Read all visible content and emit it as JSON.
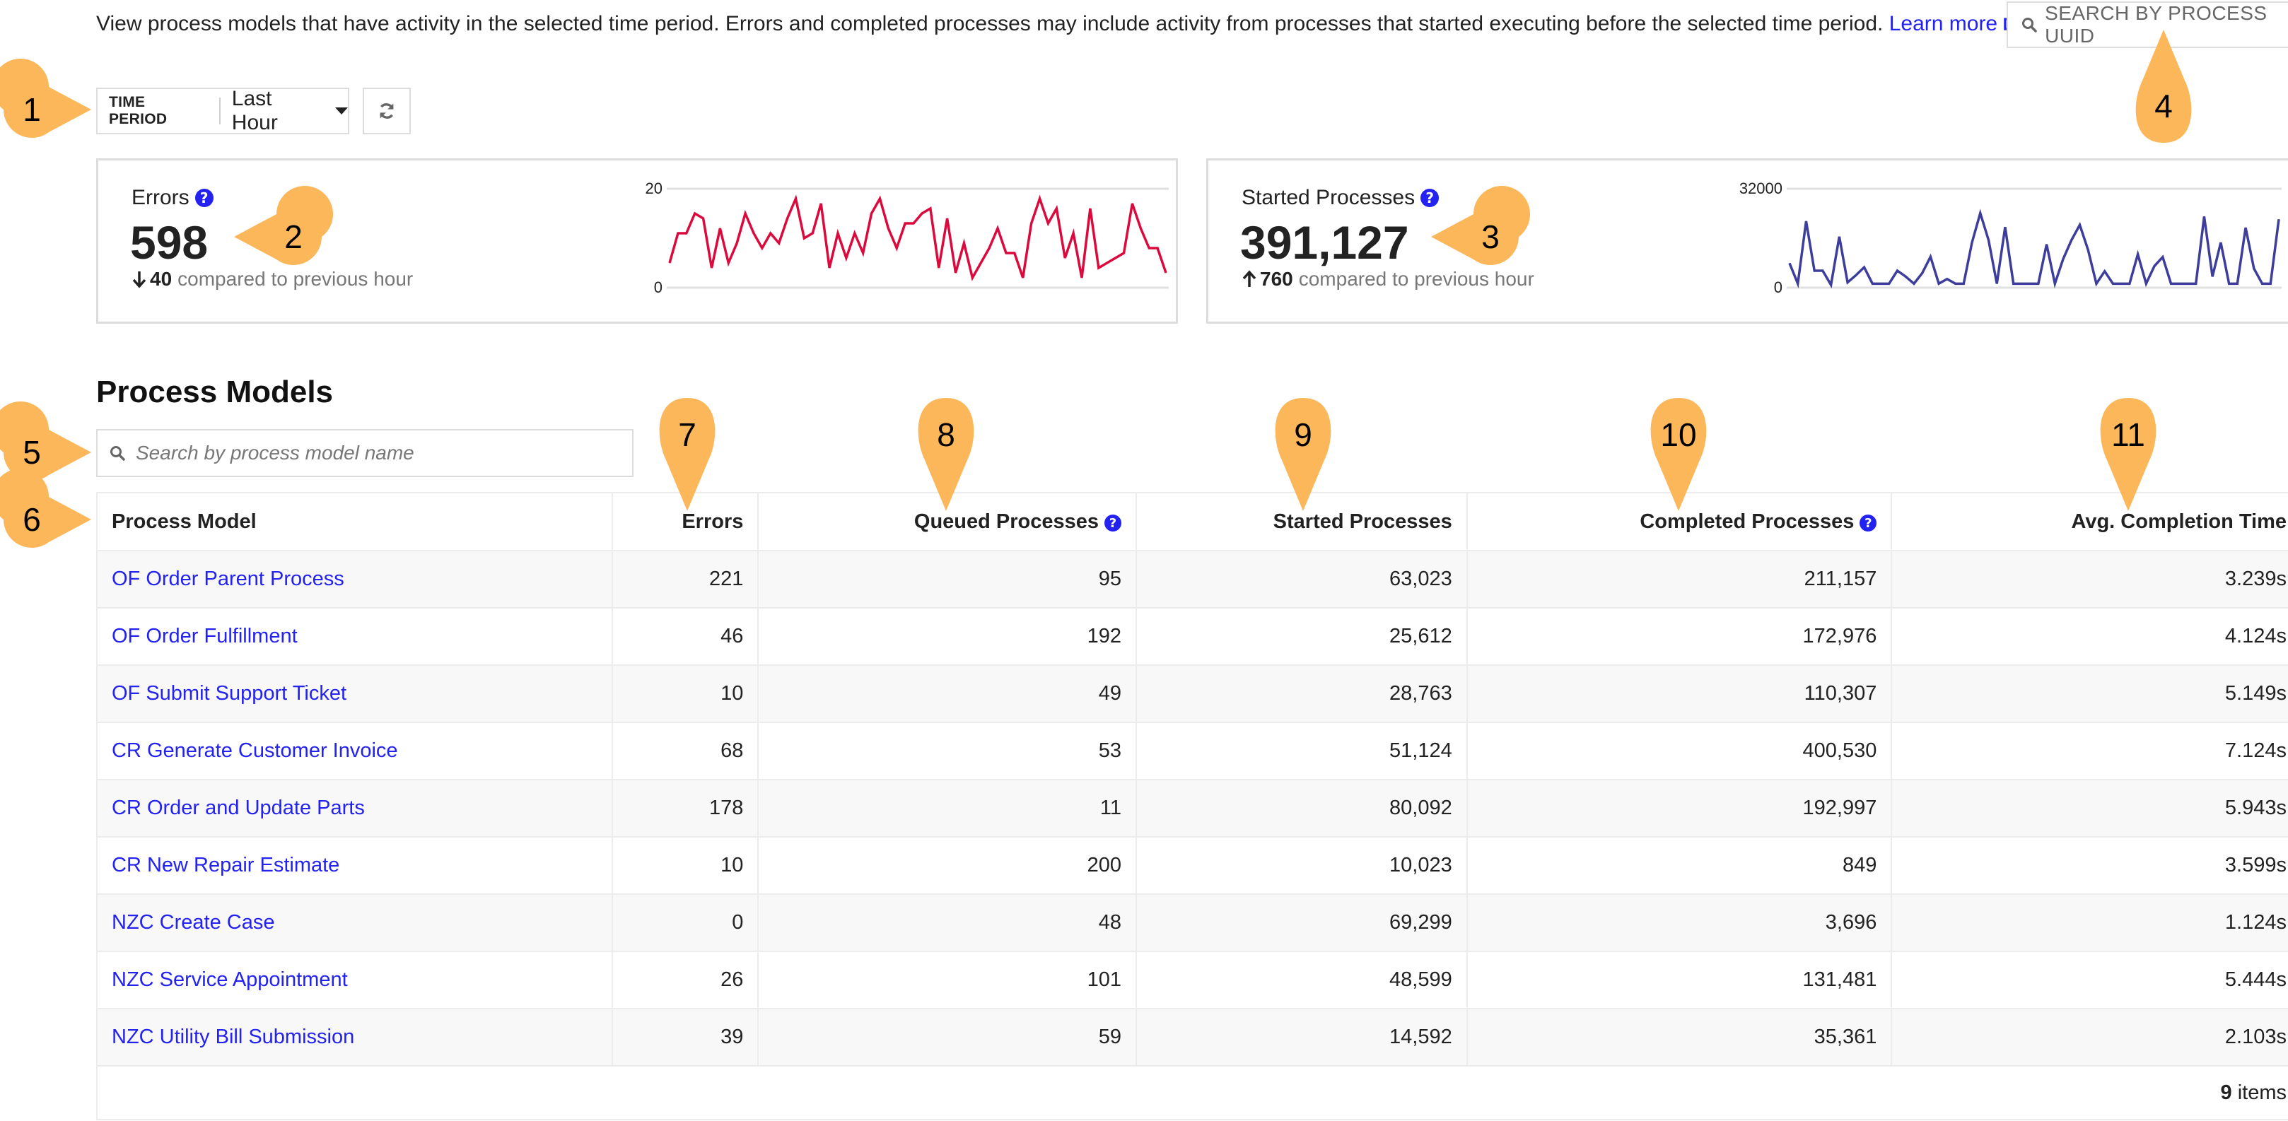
{
  "intro": {
    "text": "View process models that have activity in the selected time period. Errors and completed processes may include activity from processes that started executing before the selected time period.",
    "learn_more": "Learn more",
    "learn_more_icon": "external-link-icon"
  },
  "uuid_search": {
    "placeholder": "SEARCH BY PROCESS UUID",
    "icon": "search-icon"
  },
  "time_period": {
    "label": "TIME PERIOD",
    "value": "Last Hour",
    "icon": "caret-down-icon"
  },
  "refresh": {
    "icon": "refresh-icon"
  },
  "cards": {
    "errors": {
      "title": "Errors",
      "value": "598",
      "delta_direction": "down",
      "delta_value": "40",
      "delta_text": "compared to previous hour",
      "color": "#dc0a3c"
    },
    "started": {
      "title": "Started Processes",
      "value": "391,127",
      "delta_direction": "up",
      "delta_value": "760",
      "delta_text": "compared to previous hour",
      "color": "#3d3d9c"
    }
  },
  "chart_data": [
    {
      "type": "line",
      "title": "Errors",
      "ylim": [
        0,
        20
      ],
      "yticks": [
        "0",
        "20"
      ],
      "grid": true,
      "values": [
        5,
        11,
        11,
        15,
        14,
        4,
        12,
        5,
        9,
        15,
        11,
        8,
        11,
        9,
        14,
        18,
        10,
        11,
        17,
        4,
        11,
        6,
        11,
        7,
        15,
        18,
        12,
        8,
        13,
        13,
        15,
        16,
        4,
        14,
        3,
        9,
        2,
        5,
        8,
        12,
        7,
        7,
        2,
        13,
        18,
        13,
        16,
        6,
        11,
        2,
        16,
        4,
        5,
        6,
        7,
        17,
        12,
        8,
        8,
        3
      ]
    },
    {
      "type": "line",
      "title": "Started Processes",
      "ylim": [
        0,
        32000
      ],
      "yticks": [
        "0",
        "32000"
      ],
      "grid": true,
      "values": [
        7900,
        1300,
        21500,
        5500,
        5500,
        900,
        16500,
        1700,
        4000,
        6600,
        1300,
        1300,
        1300,
        5500,
        3600,
        1300,
        4700,
        10000,
        1300,
        2800,
        1300,
        1300,
        14600,
        24100,
        15400,
        1300,
        19600,
        1300,
        1300,
        1300,
        1300,
        14000,
        1300,
        9300,
        15400,
        20300,
        12200,
        1300,
        5300,
        1300,
        1300,
        1300,
        10800,
        1300,
        7000,
        9900,
        1300,
        1300,
        1300,
        1300,
        23000,
        3600,
        14600,
        1300,
        1300,
        19400,
        6200,
        1300,
        1300,
        22100
      ]
    }
  ],
  "process_models": {
    "heading": "Process Models",
    "search_placeholder": "Search by process model name",
    "columns": [
      {
        "label": "Process Model",
        "help": false
      },
      {
        "label": "Errors",
        "help": false
      },
      {
        "label": "Queued Processes",
        "help": true
      },
      {
        "label": "Started Processes",
        "help": false
      },
      {
        "label": "Completed Processes",
        "help": true
      },
      {
        "label": "Avg. Completion Time",
        "help": false
      }
    ],
    "rows": [
      [
        "OF Order Parent Process",
        "221",
        "95",
        "63,023",
        "211,157",
        "3.239s"
      ],
      [
        "OF Order Fulfillment",
        "46",
        "192",
        "25,612",
        "172,976",
        "4.124s"
      ],
      [
        "OF Submit Support Ticket",
        "10",
        "49",
        "28,763",
        "110,307",
        "5.149s"
      ],
      [
        "CR Generate Customer Invoice",
        "68",
        "53",
        "51,124",
        "400,530",
        "7.124s"
      ],
      [
        "CR Order and Update Parts",
        "178",
        "11",
        "80,092",
        "192,997",
        "5.943s"
      ],
      [
        "CR New Repair Estimate",
        "10",
        "200",
        "10,023",
        "849",
        "3.599s"
      ],
      [
        "NZC Create Case",
        "0",
        "48",
        "69,299",
        "3,696",
        "1.124s"
      ],
      [
        "NZC Service Appointment",
        "26",
        "101",
        "48,599",
        "131,481",
        "5.444s"
      ],
      [
        "NZC Utility Bill Submission",
        "39",
        "59",
        "14,592",
        "35,361",
        "2.103s"
      ]
    ],
    "footer_count": "9",
    "footer_label": "items"
  },
  "annotations": {
    "color": "#fbb75a",
    "markers": [
      "1",
      "2",
      "3",
      "4",
      "5",
      "6",
      "7",
      "8",
      "9",
      "10",
      "11"
    ]
  }
}
